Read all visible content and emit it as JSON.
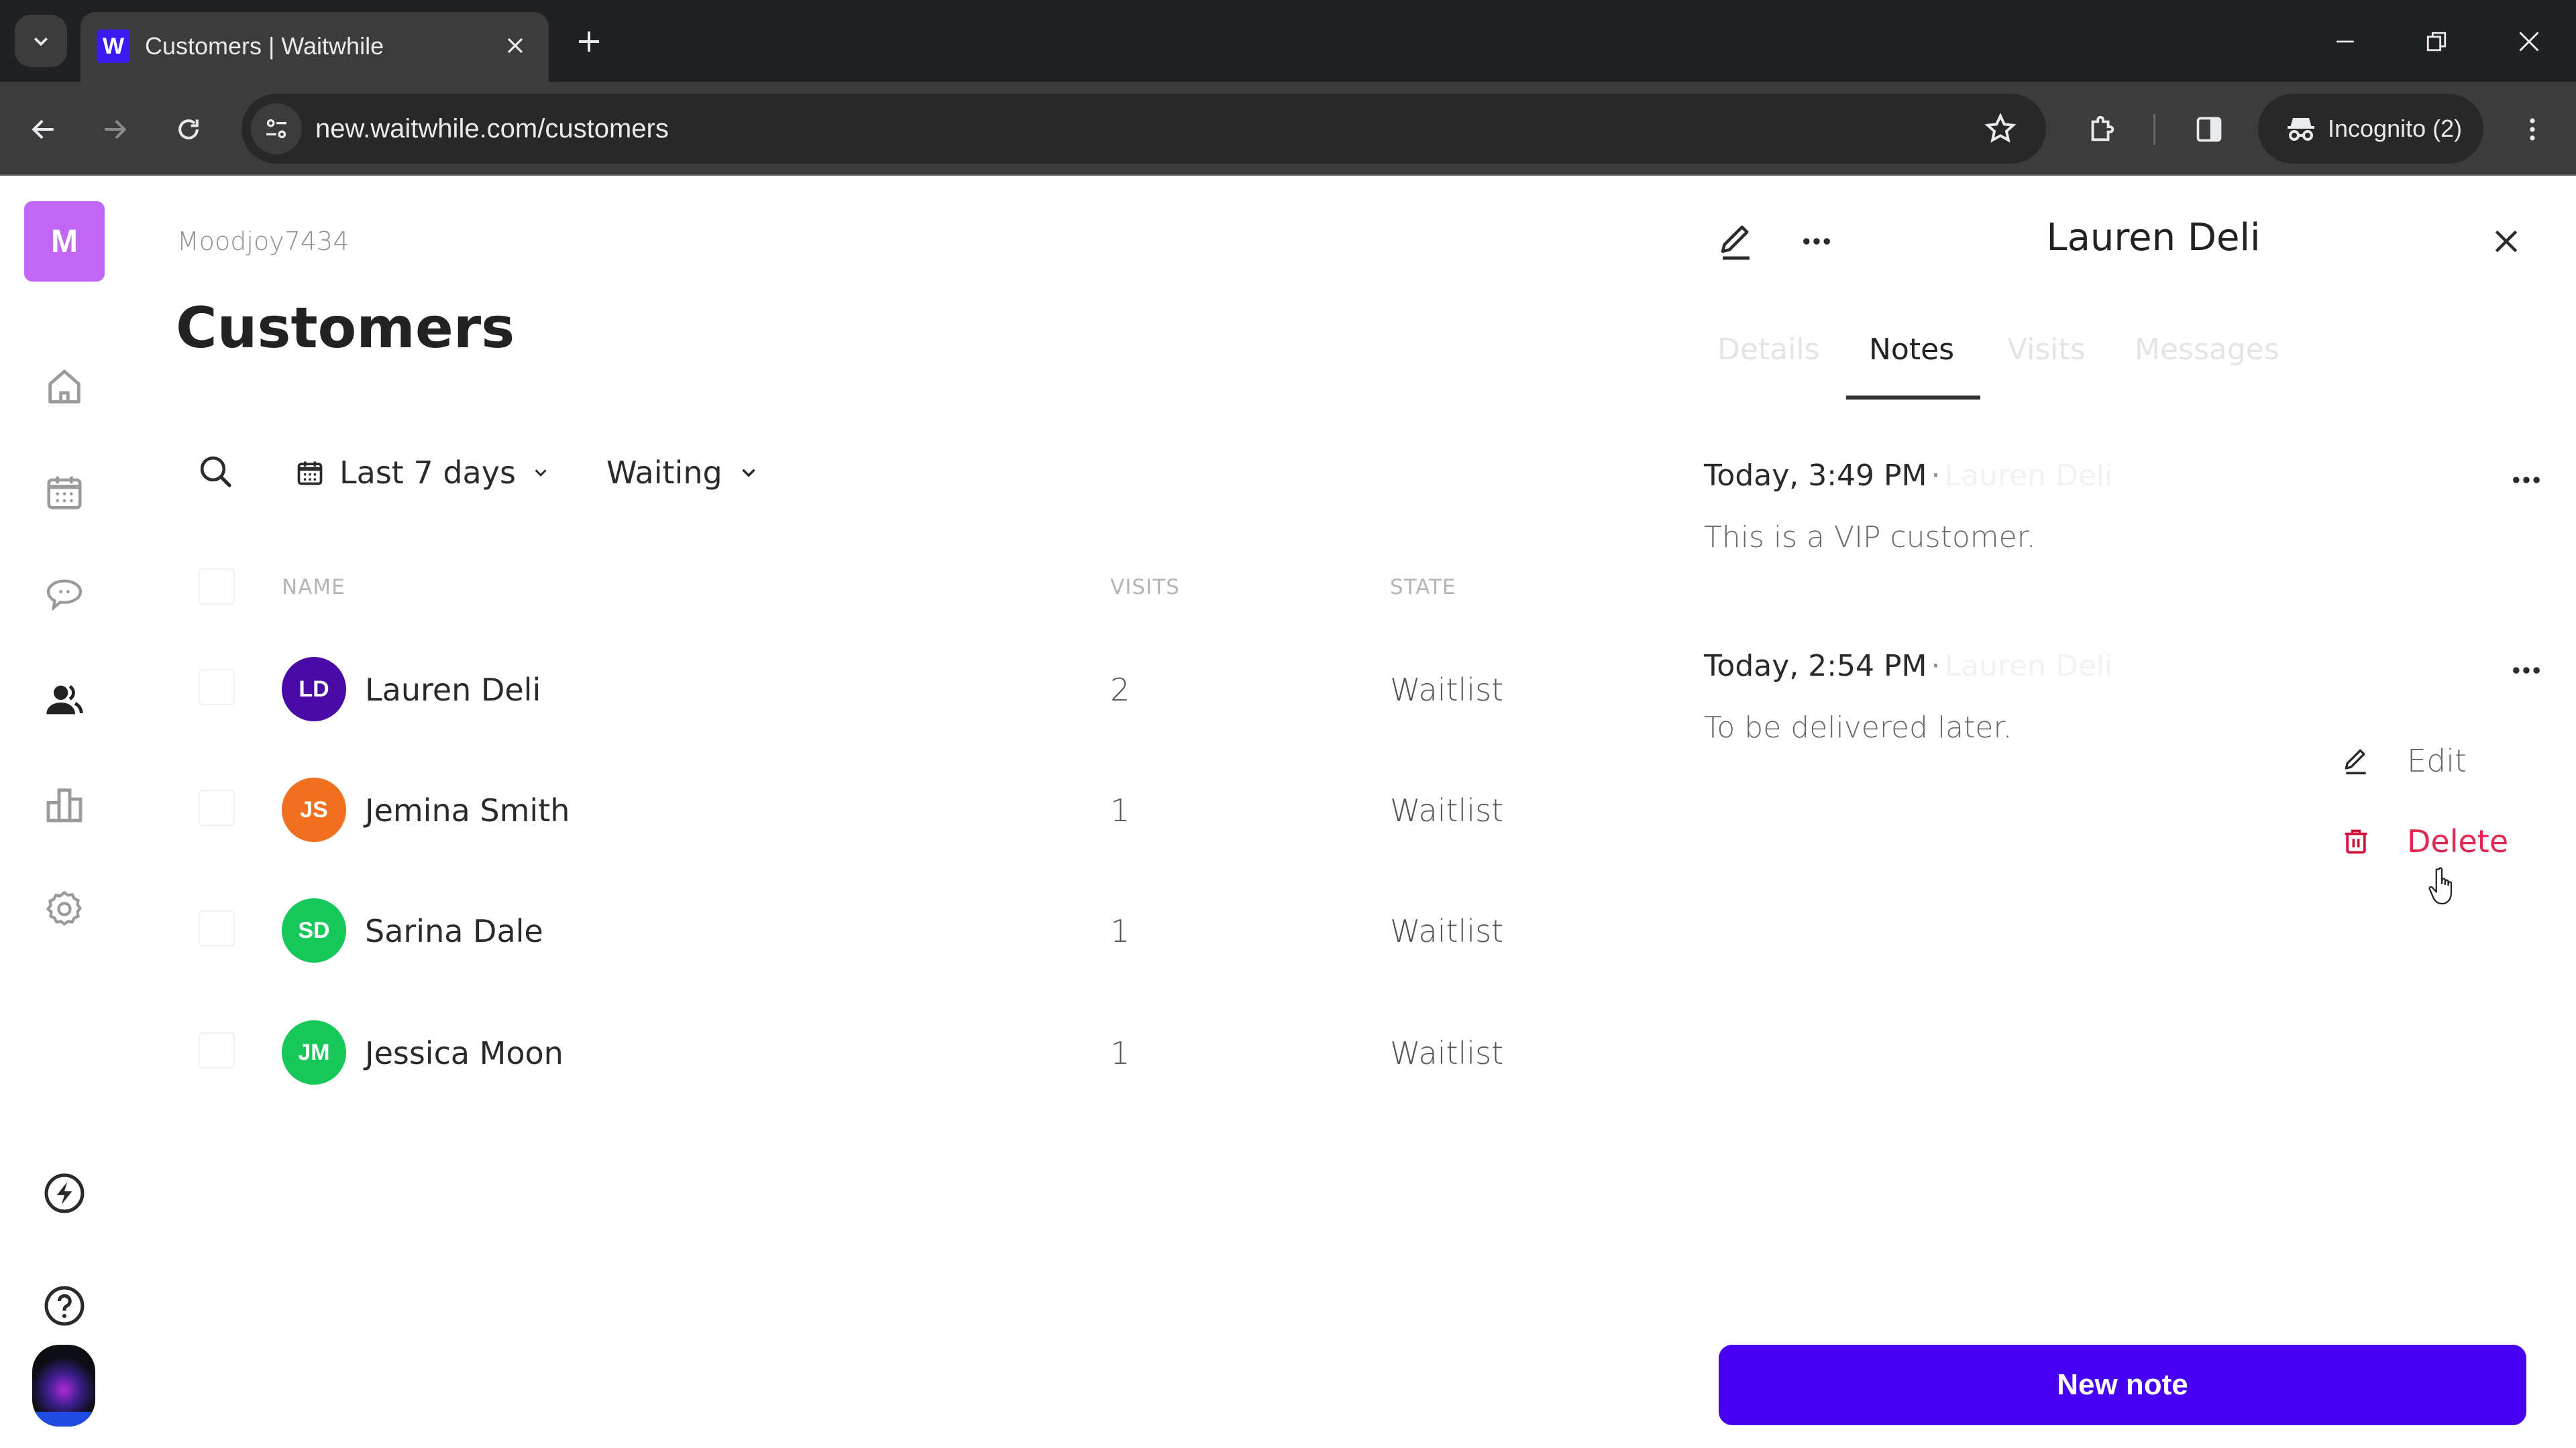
{
  "browser": {
    "tab_title": "Customers | Waitwhile",
    "favicon_letter": "W",
    "url": "new.waitwhile.com/customers",
    "incognito_label": "Incognito (2)"
  },
  "sidebar": {
    "org_initial": "M",
    "items": [
      {
        "name": "home",
        "icon": "home-icon"
      },
      {
        "name": "calendar",
        "icon": "calendar-icon"
      },
      {
        "name": "messages",
        "icon": "chat-icon"
      },
      {
        "name": "customers",
        "icon": "users-icon",
        "active": true
      },
      {
        "name": "analytics",
        "icon": "bar-chart-icon"
      },
      {
        "name": "settings",
        "icon": "gear-icon"
      }
    ],
    "bottom_items": [
      {
        "name": "whats-new",
        "icon": "lightning-icon"
      },
      {
        "name": "help",
        "icon": "help-icon"
      }
    ]
  },
  "main": {
    "org_name": "Moodjoy7434",
    "title": "Customers",
    "filters": {
      "date_range": "Last 7 days",
      "state": "Waiting"
    },
    "table": {
      "columns": [
        "NAME",
        "VISITS",
        "STATE"
      ],
      "rows": [
        {
          "initials": "LD",
          "name": "Lauren Deli",
          "visits": "2",
          "state": "Waitlist",
          "color": "#4a0aa8"
        },
        {
          "initials": "JS",
          "name": "Jemina Smith",
          "visits": "1",
          "state": "Waitlist",
          "color": "#f07020"
        },
        {
          "initials": "SD",
          "name": "Sarina Dale",
          "visits": "1",
          "state": "Waitlist",
          "color": "#16c75a"
        },
        {
          "initials": "JM",
          "name": "Jessica Moon",
          "visits": "1",
          "state": "Waitlist",
          "color": "#16c75a"
        }
      ]
    }
  },
  "panel": {
    "title": "Lauren Deli",
    "tabs": [
      {
        "label": "Details",
        "active": false
      },
      {
        "label": "Notes",
        "active": true
      },
      {
        "label": "Visits",
        "active": false
      },
      {
        "label": "Messages",
        "active": false
      }
    ],
    "notes": [
      {
        "time": "Today, 3:49 PM",
        "separator": "·",
        "author": "Lauren Deli",
        "body": "This is a VIP customer."
      },
      {
        "time": "Today, 2:54 PM",
        "separator": "·",
        "author": "Lauren Deli",
        "body": "To be delivered later."
      }
    ],
    "context_menu": {
      "edit_label": "Edit",
      "delete_label": "Delete"
    },
    "new_note_label": "New note"
  },
  "colors": {
    "brand": "#4700f2",
    "org_badge": "#c166f5",
    "danger": "#e02852"
  }
}
